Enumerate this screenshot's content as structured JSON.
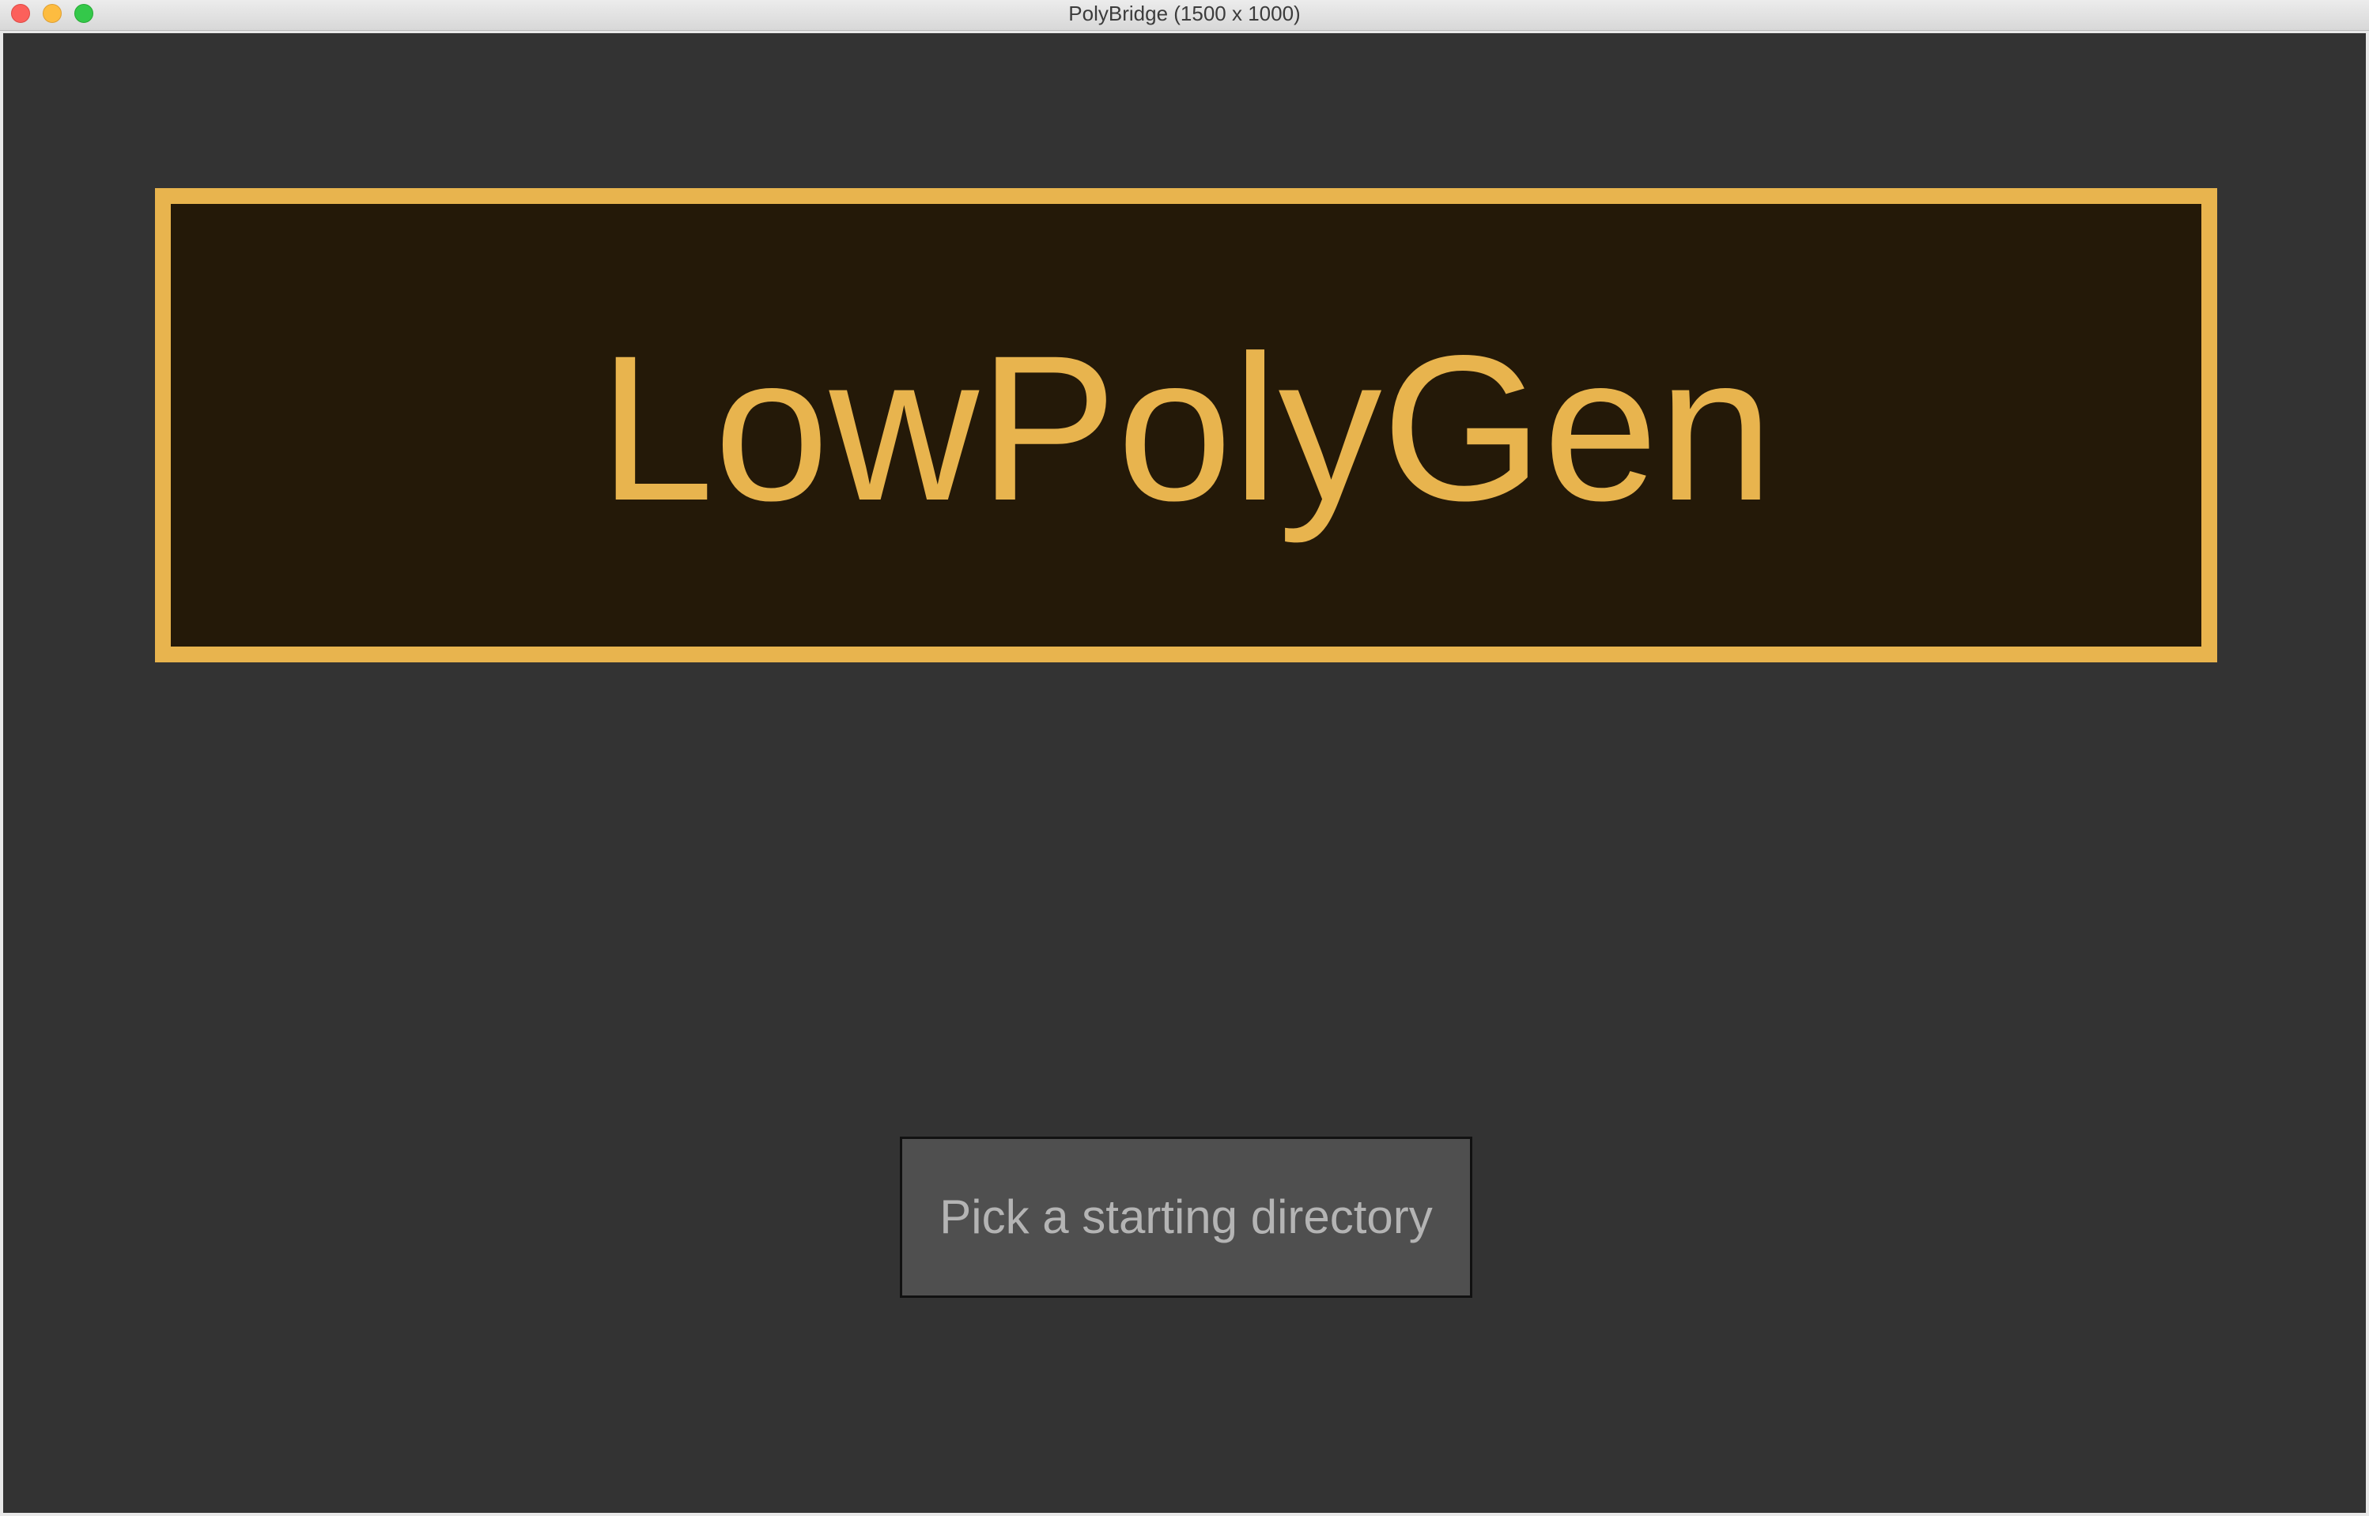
{
  "window": {
    "title": "PolyBridge (1500 x 1000)",
    "controls": [
      "close-icon",
      "minimize-icon",
      "maximize-icon"
    ]
  },
  "banner": {
    "title": "LowPolyGen"
  },
  "actions": {
    "pick_directory_label": "Pick a starting directory"
  },
  "colors": {
    "canvas_background": "#333333",
    "banner_fill": "#241908",
    "accent_gold": "#e8b44e",
    "button_fill": "#4f4f4f",
    "button_text": "#b4b4b4"
  }
}
